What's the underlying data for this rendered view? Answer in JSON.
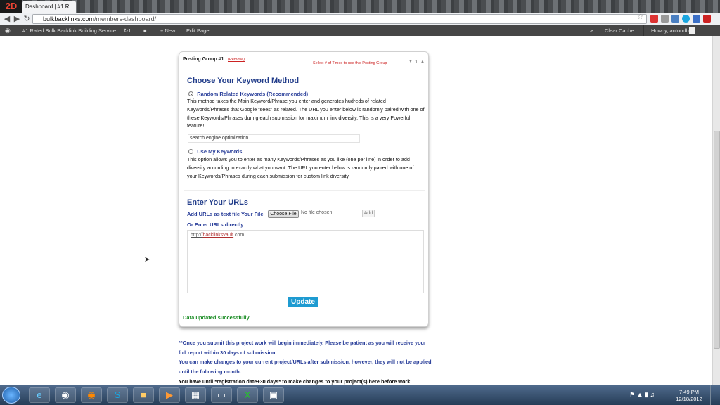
{
  "browser": {
    "logo_text": "2D",
    "tab_title": "Dashboard | #1 R",
    "url_host": "bulkbacklinks.com",
    "url_path": "/members-dashboard/"
  },
  "adminbar": {
    "site_name": "#1 Rated Bulk Backlink Building Service...",
    "updates": "1",
    "new_label": "+ New",
    "edit_label": "Edit Page",
    "clear_cache": "Clear Cache",
    "howdy": "Howdy, antondb"
  },
  "panel": {
    "group_title": "Posting Group #1",
    "remove_link": "(Remove)",
    "times_label": "Select # of Times to use this Posting Group",
    "times_value": "1",
    "keyword_heading": "Choose Your Keyword Method",
    "option1_label": "Random Related Keywords (Recommended)",
    "option1_desc": "This method takes the Main Keyword/Phrase you enter and generates hudreds of related Keywords/Phrases that Google \"sees\" as related. The URL you enter below is randomly paired with one of these Keywords/Phrases during each submission for maximum link diversity. This is a very Powerful feature!",
    "keyword_value": "search engine optimization",
    "option2_label": "Use My Keywords",
    "option2_desc": "This option allows you to enter as many Keywords/Phrases as you like (one per line) in order to add diversity according to exactly what you want. The URL you enter below is randomly paired with one of your Keywords/Phrases during each submission for custom link diversity.",
    "urls_heading": "Enter Your URLs",
    "file_label": "Add URLs as text file Your File",
    "choose_file": "Choose File",
    "no_file": "No file chosen",
    "add_button": "Add",
    "direct_label": "Or Enter URLs directly",
    "urls_value_prefix": "http://",
    "urls_value_domain": "backlinksvault",
    "urls_value_suffix": ".com",
    "update_button": "Update",
    "success_msg": "Data updated successfully"
  },
  "notes": {
    "note1": "**Once you submit this project work will begin immediately. Please be patient as you will receive your full report within 30 days of submission.",
    "note2": "You can make changes to your current project/URLs after submission, however, they will not be applied until the following month.",
    "note3": "You have until *registration date+30 days* to make changes to your project(s) here before work"
  },
  "taskbar": {
    "time": "7:49 PM",
    "date": "12/18/2012"
  },
  "colors": {
    "heading_blue": "#223d8a",
    "update_button": "#1e9bd1",
    "success_green": "#1a8c24",
    "remove_red": "#cc2222"
  },
  "icons": [
    "back-icon",
    "forward-icon",
    "reload-icon",
    "star-icon",
    "wordpress-icon",
    "comment-icon",
    "ie-icon",
    "chrome-icon",
    "firefox-icon",
    "skype-icon",
    "folder-icon",
    "media-icon",
    "network-icon",
    "excel-icon"
  ]
}
